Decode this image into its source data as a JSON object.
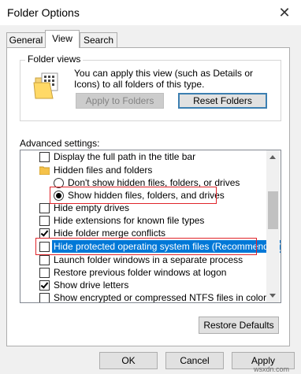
{
  "window": {
    "title": "Folder Options",
    "close_glyph": "✕"
  },
  "tabs": [
    {
      "label": "General"
    },
    {
      "label": "View"
    },
    {
      "label": "Search"
    }
  ],
  "folder_views": {
    "legend": "Folder views",
    "description": "You can apply this view (such as Details or Icons) to all folders of this type.",
    "apply_button": "Apply to Folders",
    "reset_button": "Reset Folders"
  },
  "advanced": {
    "label": "Advanced settings:",
    "items": [
      {
        "label": "Display the full path in the title bar",
        "control": "checkbox",
        "checked": false
      },
      {
        "label": "Hidden files and folders",
        "control": "folder"
      },
      {
        "label": "Don't show hidden files, folders, or drives",
        "control": "radio",
        "checked": false
      },
      {
        "label": "Show hidden files, folders, and drives",
        "control": "radio",
        "checked": true
      },
      {
        "label": "Hide empty drives",
        "control": "checkbox",
        "checked": false
      },
      {
        "label": "Hide extensions for known file types",
        "control": "checkbox",
        "checked": false
      },
      {
        "label": "Hide folder merge conflicts",
        "control": "checkbox",
        "checked": true
      },
      {
        "label": "Hide protected operating system files (Recommended)",
        "control": "checkbox",
        "checked": false
      },
      {
        "label": "Launch folder windows in a separate process",
        "control": "checkbox",
        "checked": false
      },
      {
        "label": "Restore previous folder windows at logon",
        "control": "checkbox",
        "checked": false
      },
      {
        "label": "Show drive letters",
        "control": "checkbox",
        "checked": true
      },
      {
        "label": "Show encrypted or compressed NTFS files in color",
        "control": "checkbox",
        "checked": false
      }
    ]
  },
  "buttons": {
    "restore_defaults": "Restore Defaults",
    "ok": "OK",
    "cancel": "Cancel",
    "apply": "Apply"
  },
  "watermark": "wsxdn.com",
  "colors": {
    "selection": "#0078d7",
    "annotation_box": "#e0242a",
    "focus_border": "#3c7fb1"
  }
}
